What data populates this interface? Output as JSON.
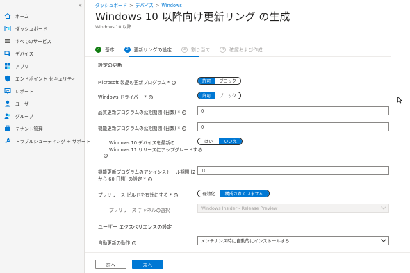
{
  "sidebar": {
    "collapse_label": "«",
    "items": [
      {
        "label": "ホーム",
        "icon": "home-icon"
      },
      {
        "label": "ダッシュボード",
        "icon": "dashboard-icon"
      },
      {
        "label": "すべてのサービス",
        "icon": "list-icon"
      },
      {
        "label": "デバイス",
        "icon": "devices-icon"
      },
      {
        "label": "アプリ",
        "icon": "apps-icon"
      },
      {
        "label": "エンドポイント セキュリティ",
        "icon": "shield-icon"
      },
      {
        "label": "レポート",
        "icon": "report-icon"
      },
      {
        "label": "ユーザー",
        "icon": "user-icon"
      },
      {
        "label": "グループ",
        "icon": "group-icon"
      },
      {
        "label": "テナント管理",
        "icon": "tenant-icon"
      },
      {
        "label": "トラブルシューティング + サポート",
        "icon": "wrench-icon"
      }
    ]
  },
  "breadcrumb": [
    "ダッシュボード",
    "デバイス",
    "Windows"
  ],
  "page": {
    "title": "Windows 10 以降向け更新リング の生成",
    "subtitle": "Windows 10 以降",
    "more": "..."
  },
  "steps": [
    {
      "number": "✓",
      "label": "基本"
    },
    {
      "number": "2",
      "label": "更新リングの設定"
    },
    {
      "number": "3",
      "label": "割り当て"
    },
    {
      "number": "4",
      "label": "確認および作成"
    }
  ],
  "sections": {
    "update_settings": "設定の更新",
    "user_experience": "ユーザー エクスペリエンスの設定"
  },
  "fields": {
    "ms_product_updates": {
      "label": "Microsoft 製品の更新プログラム *",
      "options": [
        "許可",
        "ブロック"
      ],
      "selected": "許可"
    },
    "windows_drivers": {
      "label": "Windows ドライバー *",
      "options": [
        "許可",
        "ブロック"
      ],
      "selected": "許可"
    },
    "quality_deferral": {
      "label": "品質更新プログラムの延期期間 (日数) *",
      "value": "0"
    },
    "feature_deferral": {
      "label": "機能更新プログラムの延期期間 (日数) *",
      "value": "0"
    },
    "win11_upgrade": {
      "label_line1": "Windows 10 デバイスを最新の",
      "label_line2": "Windows 11 リリースにアップグレードする",
      "options": [
        "はい",
        "いいえ"
      ],
      "selected": "いいえ"
    },
    "uninstall_period": {
      "label_line1": "機能更新プログラムのアンインストール期間 (2",
      "label_line2": "から 60 日間) の設定 *",
      "value": "10"
    },
    "prerelease": {
      "label": "プレリリース ビルドを有効にする *",
      "options": [
        "有効化",
        "構成されていません"
      ],
      "selected": "構成されていません"
    },
    "prerelease_channel": {
      "label": "プレリリース チャネルの選択",
      "value": "Windows Insider - Release Preview"
    },
    "auto_update": {
      "label": "自動更新の動作",
      "value": "メンテナンス時に自動的にインストールする"
    }
  },
  "footer": {
    "prev_label": "前へ",
    "next_label": "次へ"
  },
  "colors": {
    "accent": "#0078d4",
    "success": "#107c10"
  }
}
